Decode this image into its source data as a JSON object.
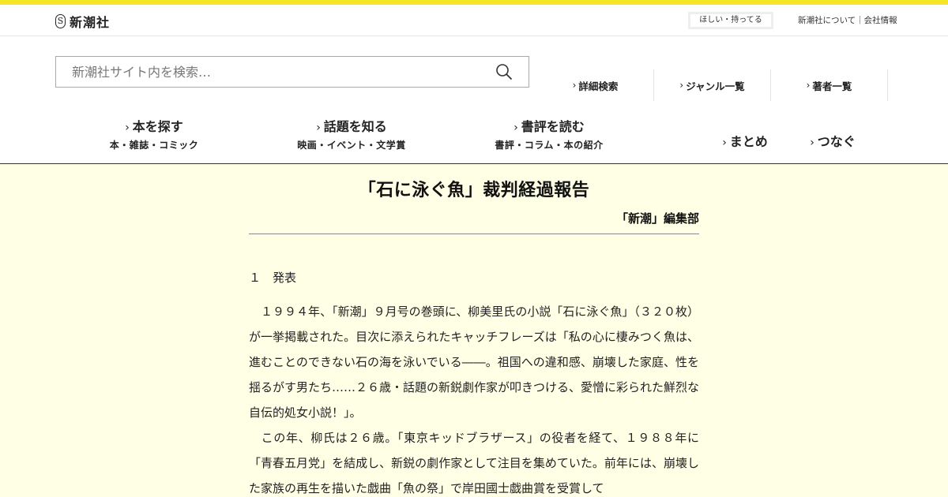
{
  "header": {
    "logo_mark": "S",
    "logo_text": "新潮社",
    "wishlist_label": "ほしい・持ってる",
    "about_label": "新潮社について｜会社情報"
  },
  "search": {
    "placeholder": "新潮社サイト内を検索…"
  },
  "sublinks": [
    {
      "label": "詳細検索"
    },
    {
      "label": "ジャンル一覧"
    },
    {
      "label": "著者一覧"
    }
  ],
  "nav": [
    {
      "label": "本を探す",
      "sub": "本・雑誌・コミック"
    },
    {
      "label": "話題を知る",
      "sub": "映画・イベント・文学賞"
    },
    {
      "label": "書評を読む",
      "sub": "書評・コラム・本の紹介"
    },
    {
      "label": "まとめ"
    },
    {
      "label": "つなぐ"
    }
  ],
  "article": {
    "title": "「石に泳ぐ魚」裁判経過報告",
    "author": "「新潮」編集部",
    "section_heading": "１　発表",
    "paragraphs": [
      "　１９９４年、「新潮」９月号の巻頭に、柳美里氏の小説「石に泳ぐ魚」（３２０枚）が一挙掲載された。目次に添えられたキャッチフレーズは「私の心に棲みつく魚は、進むことのできない石の海を泳いでいる――。祖国への違和感、崩壊した家庭、性を揺るがす男たち……２６歳・話題の新鋭劇作家が叩きつける、愛憎に彩られた鮮烈な自伝的処女小説！」。",
      "　この年、柳氏は２６歳。「東京キッドブラザース」の役者を経て、１９８８年に「青春五月党」を結成し、新鋭の劇作家として注目を集めていた。前年には、崩壊した家族の再生を描いた戯曲「魚の祭」で岸田國士戯曲賞を受賞して"
    ]
  },
  "colors": {
    "top_accent": "#f5e628",
    "content_background": "#ffffe6"
  }
}
